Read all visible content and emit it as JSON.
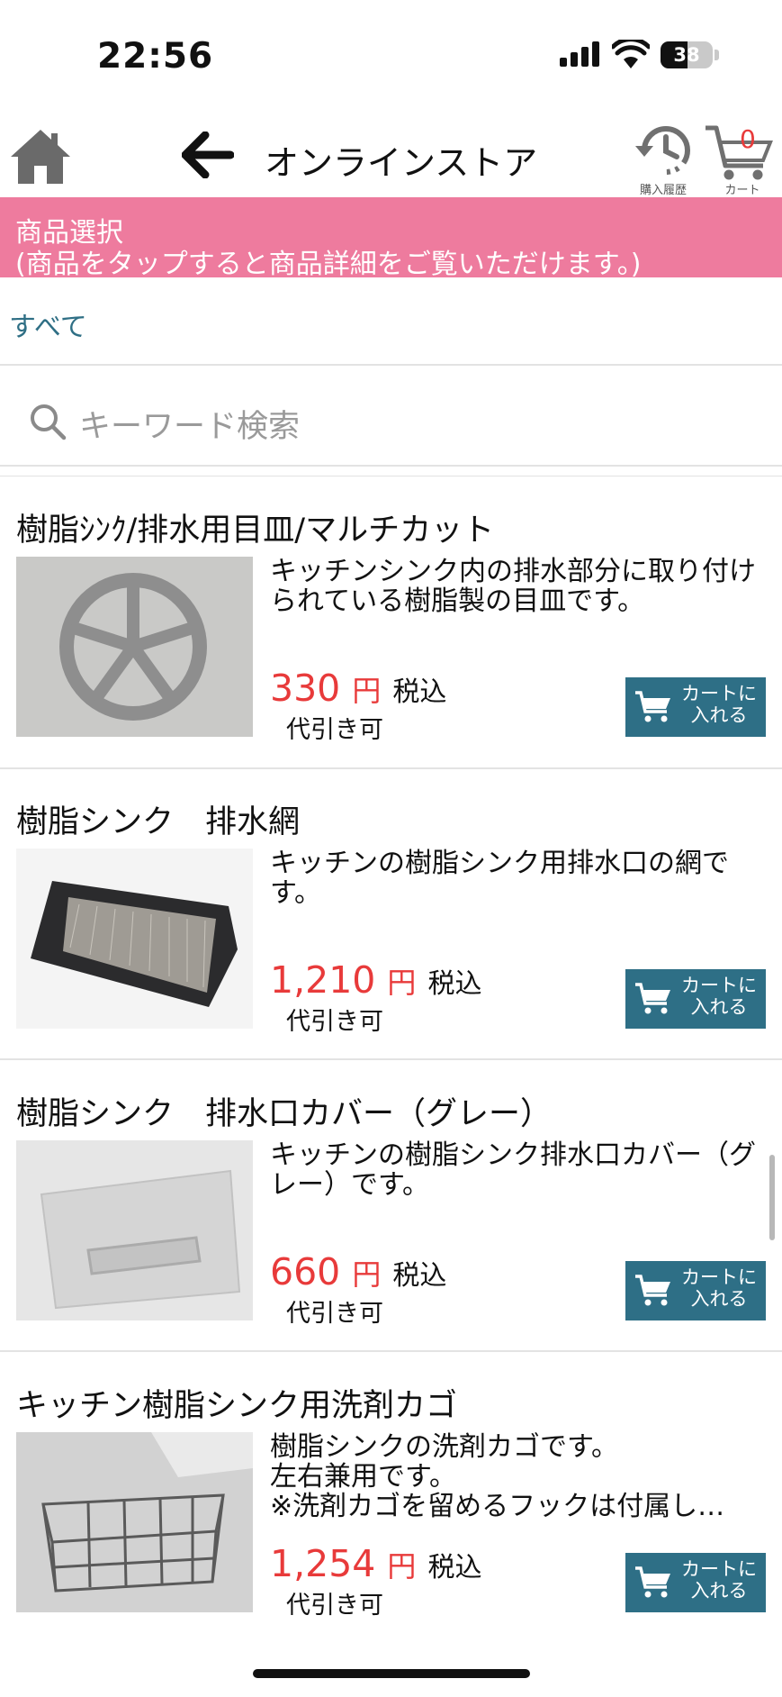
{
  "status_bar": {
    "time": "22:56",
    "battery": "38"
  },
  "header": {
    "title": "オンラインストア",
    "history_label": "購入履歴",
    "cart_label": "カート",
    "cart_count": "0"
  },
  "banner": {
    "line1": "商品選択",
    "line2": "(商品をタップすると商品詳細をご覧いただけます。)"
  },
  "category": "すべて",
  "search": {
    "placeholder": "キーワード検索"
  },
  "products": [
    {
      "title": "樹脂ｼﾝｸ/排水用目皿/マルチカット",
      "description": "キッチンシンク内の排水部分に取り付けられている樹脂製の目皿です。",
      "price": "330",
      "currency": "円",
      "tax": "税込",
      "cod": "代引き可",
      "button": "カートに入れる",
      "button_l1": "カートに",
      "button_l2": "入れる"
    },
    {
      "title": "樹脂シンク　排水網",
      "description": "キッチンの樹脂シンク用排水口の網です。",
      "price": "1,210",
      "currency": "円",
      "tax": "税込",
      "cod": "代引き可",
      "button": "カートに入れる",
      "button_l1": "カートに",
      "button_l2": "入れる"
    },
    {
      "title": "樹脂シンク　排水口カバー（グレー）",
      "description": "キッチンの樹脂シンク排水口カバー（グレー）です。",
      "price": "660",
      "currency": "円",
      "tax": "税込",
      "cod": "代引き可",
      "button": "カートに入れる",
      "button_l1": "カートに",
      "button_l2": "入れる"
    },
    {
      "title": "キッチン樹脂シンク用洗剤カゴ",
      "description_lines": [
        "樹脂シンクの洗剤カゴです。",
        "左右兼用です。",
        "※洗剤カゴを留めるフックは付属し…"
      ],
      "price": "1,254",
      "currency": "円",
      "tax": "税込",
      "cod": "代引き可",
      "button": "カートに入れる",
      "button_l1": "カートに",
      "button_l2": "入れる"
    }
  ],
  "colors": {
    "accent": "#e83a3a",
    "banner": "#ee7b9e",
    "button": "#2e6f86",
    "link": "#2f6f85"
  }
}
